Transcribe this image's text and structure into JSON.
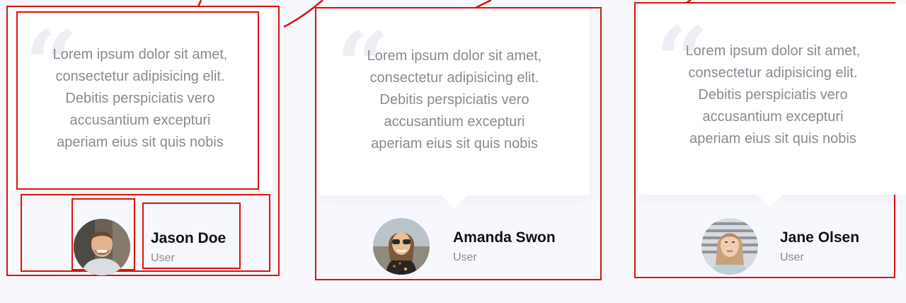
{
  "testimonials": [
    {
      "quote": "Lorem ipsum dolor sit amet,\nconsectetur adipisicing elit.\nDebitis perspiciatis vero\naccusantium excepturi\naperiam eius sit quis nobis",
      "name": "Jason Doe",
      "role": "User",
      "avatar": "man-portrait-avatar"
    },
    {
      "quote": "Lorem ipsum dolor sit amet,\nconsectetur adipisicing elit.\nDebitis perspiciatis vero\naccusantium excepturi\naperiam eius sit quis nobis",
      "name": "Amanda Swon",
      "role": "User",
      "avatar": "woman-sunglasses-portrait-avatar"
    },
    {
      "quote": "Lorem ipsum dolor sit amet,\nconsectetur adipisicing elit.\nDebitis perspiciatis vero\naccusantium excepturi\naperiam eius sit quis nobis",
      "name": "Jane Olsen",
      "role": "User",
      "avatar": "woman-portrait-avatar"
    }
  ],
  "quote_mark": "“",
  "colors": {
    "annotation": "#e01010",
    "background": "#f7f8fd",
    "bubble": "#ffffff",
    "quote_text": "#8a8a94"
  }
}
